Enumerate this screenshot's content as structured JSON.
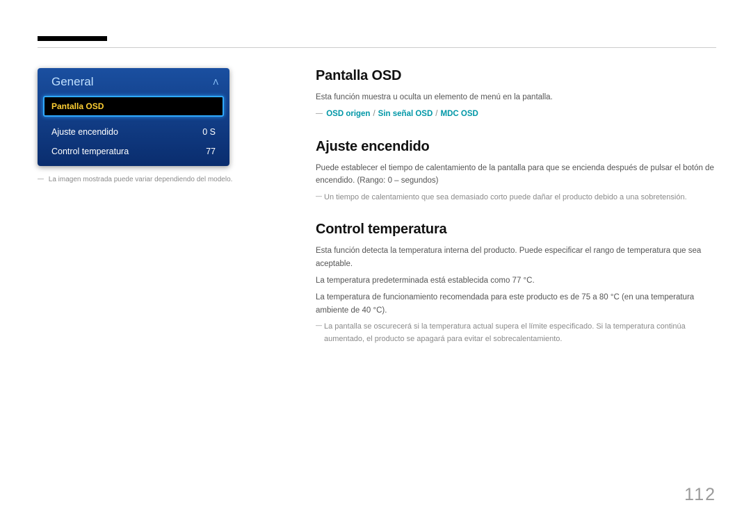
{
  "page_number": "112",
  "osd_panel": {
    "header": "General",
    "selected": "Pantalla OSD",
    "rows": [
      {
        "label": "Ajuste encendido",
        "value": "0 S"
      },
      {
        "label": "Control temperatura",
        "value": "77"
      }
    ]
  },
  "left_caption": "La imagen mostrada puede variar dependiendo del modelo.",
  "sections": {
    "pantalla_osd": {
      "title": "Pantalla OSD",
      "body": "Esta función muestra u oculta un elemento de menú en la pantalla.",
      "options": [
        "OSD origen",
        "Sin señal OSD",
        "MDC OSD"
      ]
    },
    "ajuste_encendido": {
      "title": "Ajuste encendido",
      "body": "Puede establecer el tiempo de calentamiento de la pantalla para que se encienda después de pulsar el botón de encendido. (Rango: 0 – segundos)",
      "note": "Un tiempo de calentamiento que sea demasiado corto puede dañar el producto debido a una sobretensión."
    },
    "control_temperatura": {
      "title": "Control temperatura",
      "body1": "Esta función detecta la temperatura interna del producto. Puede especificar el rango de temperatura que sea aceptable.",
      "body2": "La temperatura predeterminada está establecida como 77 °C.",
      "body3": "La temperatura de funcionamiento recomendada para este producto es de 75 a 80 °C (en una temperatura ambiente de 40 °C).",
      "note": "La pantalla se oscurecerá si la temperatura actual supera el límite especificado. Si la temperatura continúa aumentado, el producto se apagará para evitar el sobrecalentamiento."
    }
  }
}
